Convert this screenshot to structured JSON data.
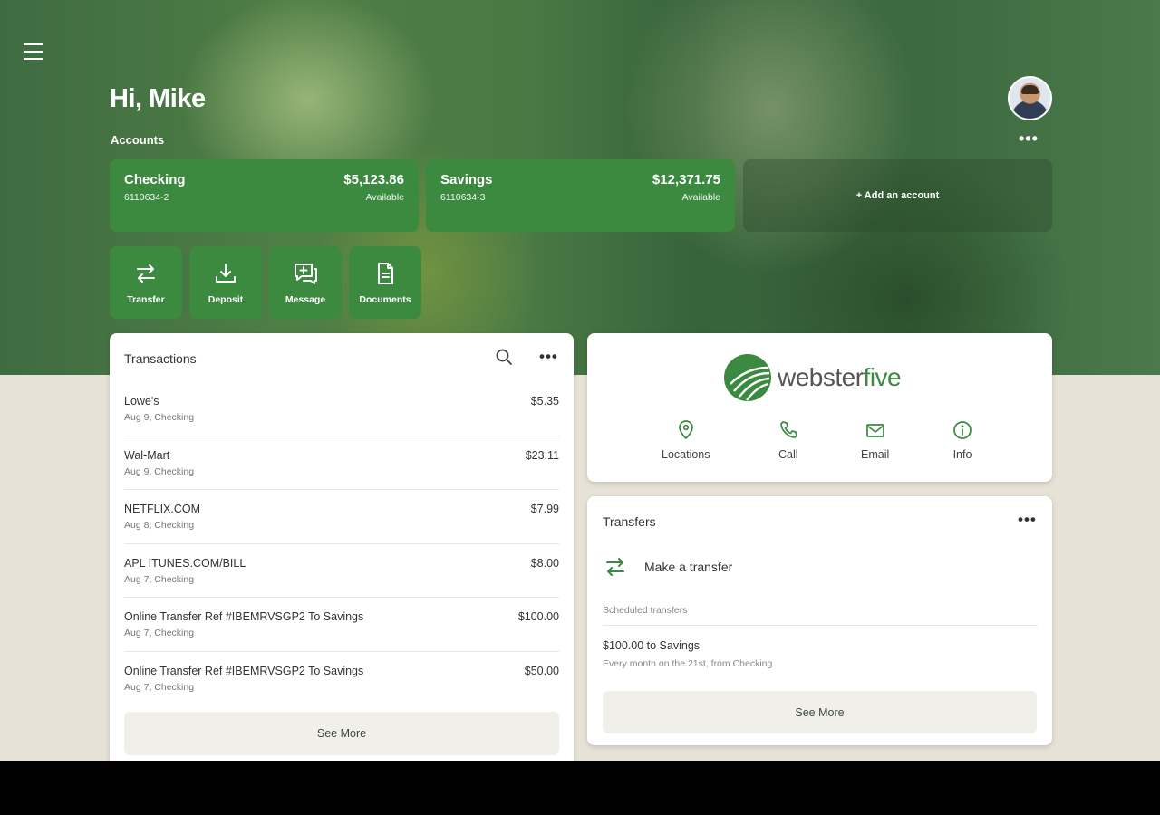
{
  "header": {
    "greeting": "Hi, Mike",
    "accounts_label": "Accounts",
    "menu_icon": "hamburger-icon",
    "more_label": "•••"
  },
  "accounts": [
    {
      "name": "Checking",
      "number": "6110634-2",
      "balance": "$5,123.86",
      "balance_label": "Available"
    },
    {
      "name": "Savings",
      "number": "6110634-3",
      "balance": "$12,371.75",
      "balance_label": "Available"
    }
  ],
  "add_account_label": "+ Add an account",
  "quick_actions": [
    {
      "label": "Transfer",
      "icon": "transfer-icon"
    },
    {
      "label": "Deposit",
      "icon": "deposit-icon"
    },
    {
      "label": "Message",
      "icon": "message-icon"
    },
    {
      "label": "Documents",
      "icon": "document-icon"
    }
  ],
  "transactions": {
    "title": "Transactions",
    "more_label": "•••",
    "items": [
      {
        "description": "Lowe's",
        "meta": "Aug 9, Checking",
        "amount": "$5.35"
      },
      {
        "description": "Wal-Mart",
        "meta": "Aug 9, Checking",
        "amount": "$23.11"
      },
      {
        "description": "NETFLIX.COM",
        "meta": "Aug 8, Checking",
        "amount": "$7.99"
      },
      {
        "description": "APL ITUNES.COM/BILL",
        "meta": "Aug 7, Checking",
        "amount": "$8.00"
      },
      {
        "description": "Online Transfer Ref #IBEMRVSGP2 To Savings",
        "meta": "Aug 7, Checking",
        "amount": "$100.00"
      },
      {
        "description": "Online Transfer Ref #IBEMRVSGP2 To Savings",
        "meta": "Aug 7, Checking",
        "amount": "$50.00"
      }
    ],
    "see_more": "See More"
  },
  "brand": {
    "name_part1": "webster",
    "name_part2": "five",
    "contacts": [
      {
        "label": "Locations",
        "icon": "location-pin-icon"
      },
      {
        "label": "Call",
        "icon": "phone-icon"
      },
      {
        "label": "Email",
        "icon": "email-icon"
      },
      {
        "label": "Info",
        "icon": "info-icon"
      }
    ]
  },
  "transfers": {
    "title": "Transfers",
    "more_label": "•••",
    "make_transfer": "Make a transfer",
    "scheduled_label": "Scheduled transfers",
    "scheduled": [
      {
        "title": "$100.00 to Savings",
        "subtitle": "Every month on the 21st, from Checking"
      }
    ],
    "see_more": "See More"
  },
  "colors": {
    "brand_green": "#3b8a40",
    "page_bg": "#e6e2d8"
  }
}
